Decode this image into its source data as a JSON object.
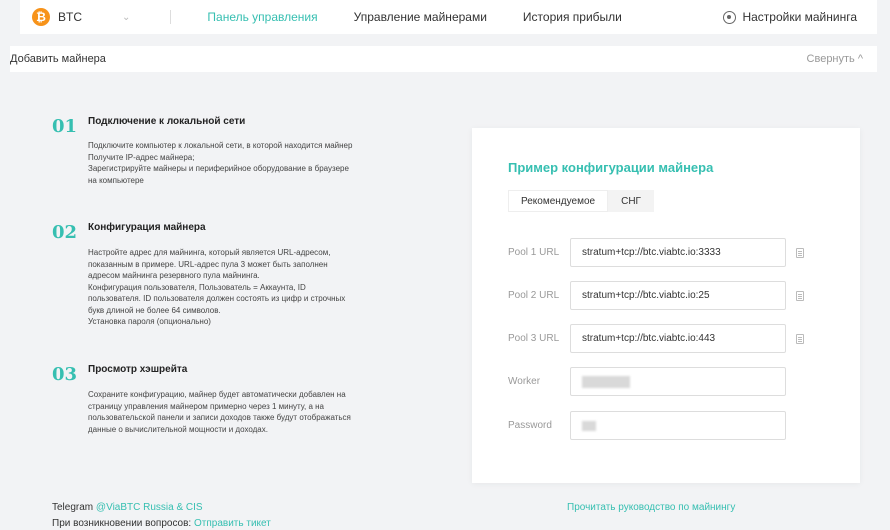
{
  "header": {
    "coin": "BTC",
    "coin_symbol": "₿",
    "nav": [
      "Панель управления",
      "Управление майнерами",
      "История прибыли"
    ],
    "settings_label": "Настройки майнинга"
  },
  "add_bar": {
    "title": "Добавить майнера",
    "collapse_label": "Свернуть ^"
  },
  "steps": [
    {
      "num": "01",
      "title": "Подключение к локальной сети",
      "lines": [
        "Подключите компьютер к локальной сети, в которой находится майнер",
        "Получите IP-адрес майнера;",
        "Зарегистрируйте майнеры и периферийное оборудование в браузере",
        "на компьютере"
      ]
    },
    {
      "num": "02",
      "title": "Конфигурация майнера",
      "lines": [
        "Настройте адрес для майнинга, который является URL-адресом,",
        "показанным в примере. URL-адрес пула 3 может быть заполнен",
        "адресом майнинга резервного пула майнинга.",
        "Конфигурация пользователя, Пользователь = Аккаунта, ID",
        "пользователя. ID пользователя должен состоять из цифр и строчных",
        "букв длиной не более 64 символов.",
        "Установка пароля (опционально)"
      ]
    },
    {
      "num": "03",
      "title": "Просмотр хэшрейта",
      "lines": [
        "Сохраните конфигурацию, майнер будет автоматически добавлен на",
        "страницу управления майнером примерно через 1 минуту, а на",
        "пользовательской панели и записи доходов также будут отображаться",
        "данные о вычислительной мощности и доходах."
      ]
    }
  ],
  "config": {
    "title": "Пример конфигурации майнера",
    "tabs": [
      "Рекомендуемое",
      "СНГ"
    ],
    "fields": [
      {
        "label": "Pool 1 URL",
        "value": "stratum+tcp://btc.viabtc.io:3333"
      },
      {
        "label": "Pool 2 URL",
        "value": "stratum+tcp://btc.viabtc.io:25"
      },
      {
        "label": "Pool 3 URL",
        "value": "stratum+tcp://btc.viabtc.io:443"
      },
      {
        "label": "Worker",
        "value": ""
      },
      {
        "label": "Password",
        "value": ""
      }
    ]
  },
  "guide_link": "Прочитать руководство по майнингу",
  "footer": {
    "telegram_label": "Telegram",
    "telegram_link": "@ViaBTC Russia & CIS",
    "question_label": "При возникновении вопросов:",
    "ticket_link": "Отправить тикет"
  }
}
